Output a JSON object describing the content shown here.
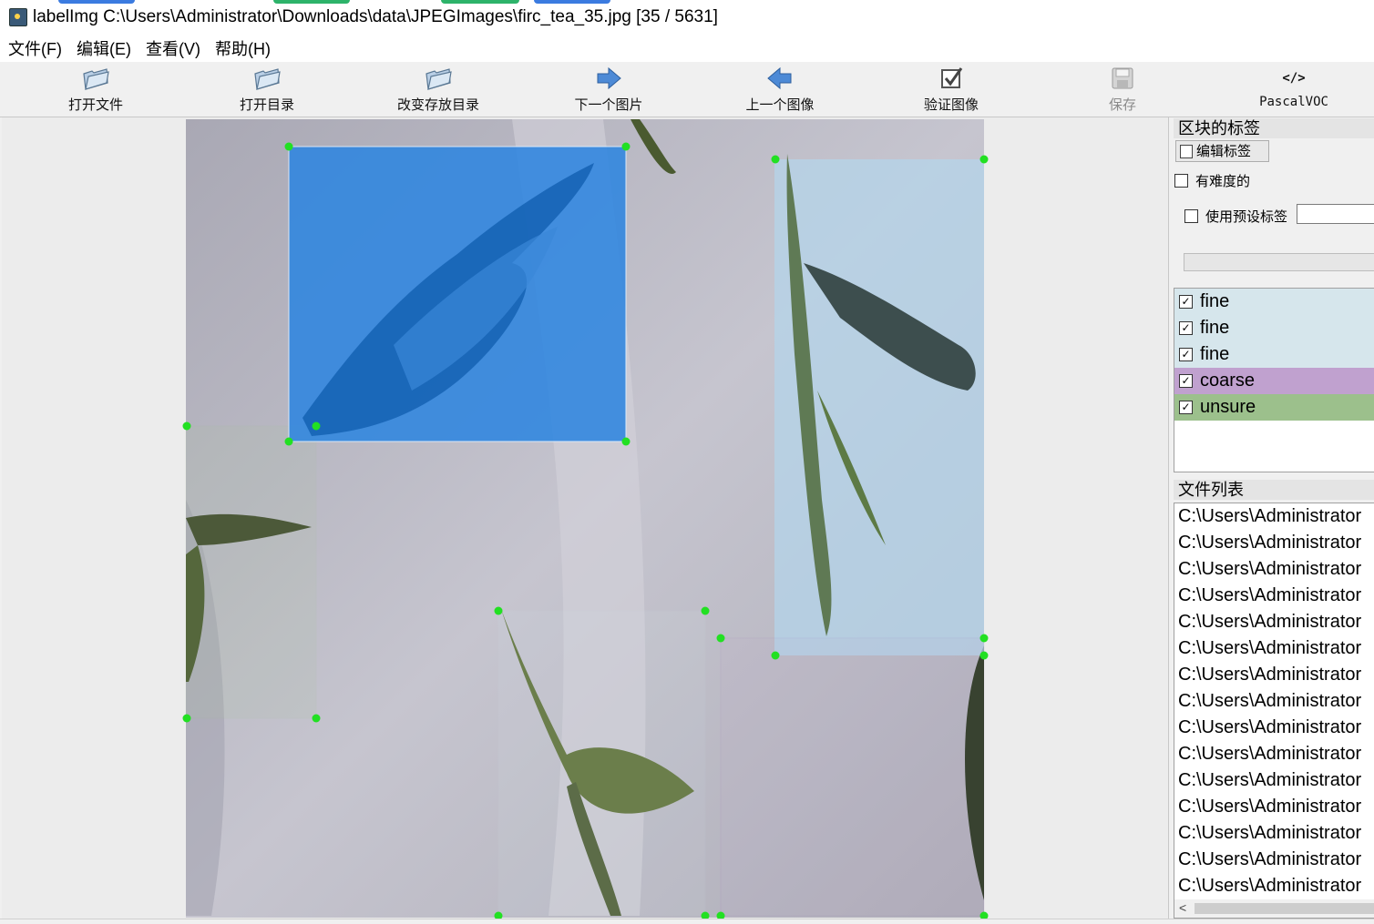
{
  "window": {
    "title": "labelImg C:\\Users\\Administrator\\Downloads\\data\\JPEGImages\\firc_tea_35.jpg [35 / 5631]"
  },
  "menu": [
    "文件(F)",
    "编辑(E)",
    "查看(V)",
    "帮助(H)"
  ],
  "toolbar": {
    "open_file": "打开文件",
    "open_dir": "打开目录",
    "change_save_dir": "改变存放目录",
    "next_image": "下一个图片",
    "prev_image": "上一个图像",
    "verify_image": "验证图像",
    "save": "保存",
    "format": "PascalVOC",
    "format_icon_text": "</>"
  },
  "dock": {
    "box_labels_title": "区块的标签",
    "edit_label_button": "编辑标签",
    "difficult_label": "有难度的",
    "use_default_label": "使用预设标签",
    "labels": [
      {
        "text": "fine",
        "checked": true,
        "color": "#d6e6ec"
      },
      {
        "text": "fine",
        "checked": true,
        "color": "#d6e6ec"
      },
      {
        "text": "fine",
        "checked": true,
        "color": "#d6e6ec"
      },
      {
        "text": "coarse",
        "checked": true,
        "color": "#c0a1cf"
      },
      {
        "text": "unsure",
        "checked": true,
        "color": "#9cc08c"
      }
    ],
    "file_list_title": "文件列表",
    "files": [
      "C:\\Users\\Administrator",
      "C:\\Users\\Administrator",
      "C:\\Users\\Administrator",
      "C:\\Users\\Administrator",
      "C:\\Users\\Administrator",
      "C:\\Users\\Administrator",
      "C:\\Users\\Administrator",
      "C:\\Users\\Administrator",
      "C:\\Users\\Administrator",
      "C:\\Users\\Administrator",
      "C:\\Users\\Administrator",
      "C:\\Users\\Administrator",
      "C:\\Users\\Administrator",
      "C:\\Users\\Administrator",
      "C:\\Users\\Administrator"
    ]
  },
  "colors": {
    "selected_box_fill": "#2f86e0",
    "box_handle": "#22e022",
    "fine_box_fill": "#b4d4ea",
    "coarse_box_stroke": "#9a68b8"
  }
}
